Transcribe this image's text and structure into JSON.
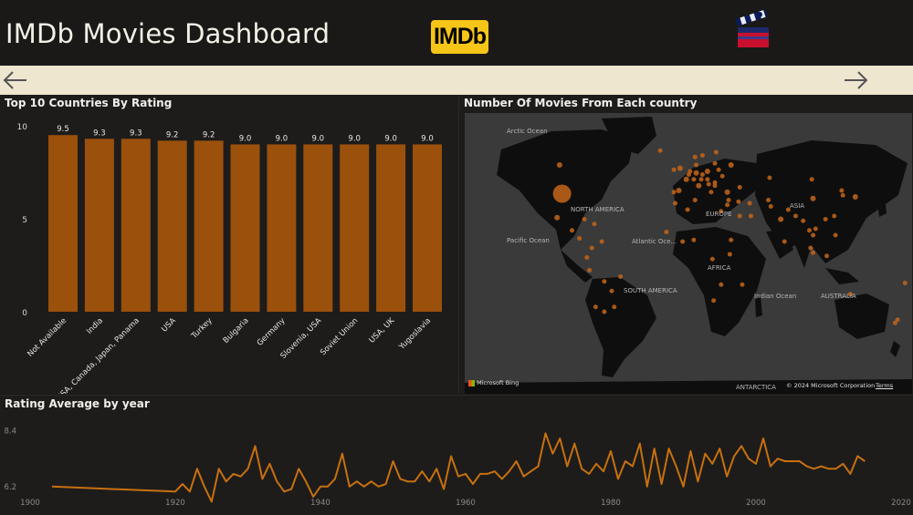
{
  "header": {
    "title": "IMDb Movies Dashboard",
    "logo_text": "IMDb"
  },
  "bar_panel": {
    "title": "Top 10 Countries By Rating"
  },
  "map_panel": {
    "title": "Number Of Movies From Each country",
    "labels": {
      "arctic": "Arctic Ocean",
      "north_america": "NORTH AMERICA",
      "europe": "EUROPE",
      "asia": "ASIA",
      "pacific": "Pacific Ocean",
      "atlantic": "Atlantic Oce...",
      "africa": "AFRICA",
      "south_america": "SOUTH AMERICA",
      "indian": "Indian Ocean",
      "australia": "AUSTRALIA",
      "antarctica": "ANTARCTICA"
    },
    "bing": "Microsoft Bing",
    "copyright": "© 2024 Microsoft Corporation",
    "terms": "Terms"
  },
  "line_panel": {
    "title": "Rating Average by year"
  },
  "colors": {
    "bar": "#9b500c",
    "line": "#c8700f",
    "dot": "#c4651a",
    "nav_bg": "#efe6d0"
  },
  "chart_data": [
    {
      "type": "bar",
      "title": "Top 10 Countries By Rating",
      "categories": [
        "Not Available",
        "India",
        "USA, Canada, Japan, Panama",
        "USA",
        "Turkey",
        "Bulgaria",
        "Germany",
        "Slovenia, USA",
        "Soviet Union",
        "USA, UK",
        "Yugoslavia"
      ],
      "values": [
        9.5,
        9.3,
        9.3,
        9.2,
        9.2,
        9.0,
        9.0,
        9.0,
        9.0,
        9.0,
        9.0
      ],
      "value_labels": [
        "9.5",
        "9.3",
        "9.3",
        "9.2",
        "9.2",
        "9.0",
        "9.0",
        "9.0",
        "9.0",
        "9.0",
        "9.0"
      ],
      "yticks": [
        "0",
        "5",
        "10"
      ],
      "ylim": [
        0,
        10
      ],
      "grid": false
    },
    {
      "type": "line",
      "title": "Rating Average by year",
      "x": [
        1903,
        1920,
        1921,
        1922,
        1923,
        1924,
        1925,
        1926,
        1927,
        1928,
        1929,
        1930,
        1931,
        1932,
        1933,
        1934,
        1935,
        1936,
        1937,
        1938,
        1939,
        1940,
        1941,
        1942,
        1943,
        1944,
        1945,
        1946,
        1947,
        1948,
        1949,
        1950,
        1951,
        1952,
        1953,
        1954,
        1955,
        1956,
        1957,
        1958,
        1959,
        1960,
        1961,
        1962,
        1963,
        1964,
        1965,
        1966,
        1967,
        1968,
        1969,
        1970,
        1971,
        1972,
        1973,
        1974,
        1975,
        1976,
        1977,
        1978,
        1979,
        1980,
        1981,
        1982,
        1983,
        1984,
        1985,
        1986,
        1987,
        1988,
        1989,
        1990,
        1991,
        1992,
        1993,
        1994,
        1995,
        1996,
        1997,
        1998,
        1999,
        2000,
        2001,
        2002,
        2003,
        2004,
        2005,
        2006,
        2007,
        2008,
        2009,
        2010,
        2011,
        2012,
        2013,
        2014,
        2015
      ],
      "y": [
        6.2,
        6.0,
        6.3,
        6.0,
        6.9,
        6.2,
        5.6,
        6.9,
        6.4,
        6.7,
        6.6,
        6.9,
        7.8,
        6.5,
        7.1,
        6.4,
        6.0,
        6.1,
        6.9,
        6.4,
        5.8,
        6.2,
        6.2,
        6.5,
        7.5,
        6.2,
        6.4,
        6.2,
        6.4,
        6.2,
        6.3,
        7.2,
        6.5,
        6.4,
        6.4,
        6.8,
        6.4,
        6.9,
        6.1,
        7.4,
        6.6,
        6.7,
        6.3,
        6.7,
        6.7,
        6.8,
        6.5,
        6.8,
        7.2,
        6.6,
        6.8,
        7.0,
        8.3,
        7.5,
        8.1,
        7.0,
        7.9,
        6.9,
        6.7,
        7.1,
        6.8,
        7.6,
        6.5,
        7.2,
        7.0,
        7.9,
        6.2,
        7.7,
        6.3,
        7.7,
        7.0,
        6.2,
        7.6,
        6.4,
        7.5,
        7.1,
        7.7,
        6.6,
        7.4,
        7.8,
        7.3,
        7.1,
        8.1,
        7.0,
        7.3,
        7.2,
        7.2,
        7.2,
        7.0,
        6.9,
        7.0,
        6.9,
        6.9,
        7.1,
        6.7,
        7.4,
        7.2,
        7.3,
        7.1,
        7.2,
        8.2
      ],
      "yticks": [
        "6.2",
        "8.4"
      ],
      "xticks": [
        "1900",
        "1920",
        "1940",
        "1960",
        "1980",
        "2000",
        "2020"
      ],
      "xlim": [
        1900,
        2020
      ],
      "ylim": [
        5.4,
        9.0
      ],
      "grid": false
    }
  ],
  "map_data": {
    "type": "bubble-map",
    "points": [
      {
        "lon": -98,
        "lat": 38,
        "r": 10
      },
      {
        "lon": -100,
        "lat": 56,
        "r": 3
      },
      {
        "lon": -102,
        "lat": 23,
        "r": 3
      },
      {
        "lon": -90,
        "lat": 15,
        "r": 2.5
      },
      {
        "lon": -84,
        "lat": 10,
        "r": 2.5
      },
      {
        "lon": -80,
        "lat": 22,
        "r": 2.5
      },
      {
        "lon": -72,
        "lat": 19,
        "r": 2.5
      },
      {
        "lon": -74,
        "lat": 4,
        "r": 2.5
      },
      {
        "lon": -66,
        "lat": 8,
        "r": 2.5
      },
      {
        "lon": -78,
        "lat": -2,
        "r": 2.5
      },
      {
        "lon": -76,
        "lat": -10,
        "r": 2.5
      },
      {
        "lon": -64,
        "lat": -17,
        "r": 2.5
      },
      {
        "lon": -51,
        "lat": -14,
        "r": 2.5
      },
      {
        "lon": -58,
        "lat": -23,
        "r": 2.5
      },
      {
        "lon": -71,
        "lat": -33,
        "r": 2.5
      },
      {
        "lon": -64,
        "lat": -36,
        "r": 2.5
      },
      {
        "lon": -56,
        "lat": -33,
        "r": 2.5
      },
      {
        "lon": -19,
        "lat": 65,
        "r": 2.5
      },
      {
        "lon": -8,
        "lat": 53,
        "r": 2.5
      },
      {
        "lon": -3,
        "lat": 54,
        "r": 3
      },
      {
        "lon": 2,
        "lat": 47,
        "r": 3
      },
      {
        "lon": 5,
        "lat": 52,
        "r": 2.5
      },
      {
        "lon": 4,
        "lat": 50,
        "r": 2.5
      },
      {
        "lon": 10,
        "lat": 51,
        "r": 3
      },
      {
        "lon": 8,
        "lat": 47,
        "r": 2.5
      },
      {
        "lon": 14,
        "lat": 47,
        "r": 2.5
      },
      {
        "lon": 12,
        "lat": 43,
        "r": 3
      },
      {
        "lon": -4,
        "lat": 40,
        "r": 3
      },
      {
        "lon": -8,
        "lat": 39,
        "r": 2.5
      },
      {
        "lon": 10,
        "lat": 56,
        "r": 2.5
      },
      {
        "lon": 15,
        "lat": 62,
        "r": 2.5
      },
      {
        "lon": 9,
        "lat": 61,
        "r": 2.5
      },
      {
        "lon": 26,
        "lat": 64,
        "r": 2.5
      },
      {
        "lon": 19,
        "lat": 52,
        "r": 3
      },
      {
        "lon": 15,
        "lat": 50,
        "r": 2.5
      },
      {
        "lon": 19,
        "lat": 47,
        "r": 2.5
      },
      {
        "lon": 20,
        "lat": 44,
        "r": 2.5
      },
      {
        "lon": 25,
        "lat": 45,
        "r": 2.5
      },
      {
        "lon": 25,
        "lat": 43,
        "r": 2.5
      },
      {
        "lon": 22,
        "lat": 39,
        "r": 2.5
      },
      {
        "lon": 35,
        "lat": 39,
        "r": 3
      },
      {
        "lon": 31,
        "lat": 49,
        "r": 2.5
      },
      {
        "lon": 28,
        "lat": 53,
        "r": 2.5
      },
      {
        "lon": 38,
        "lat": 56,
        "r": 3
      },
      {
        "lon": 25,
        "lat": 57,
        "r": 2.5
      },
      {
        "lon": 45,
        "lat": 42,
        "r": 2.5
      },
      {
        "lon": 35,
        "lat": 31,
        "r": 2.5
      },
      {
        "lon": 36,
        "lat": 34,
        "r": 2.5
      },
      {
        "lon": 44,
        "lat": 33,
        "r": 2.5
      },
      {
        "lon": 53,
        "lat": 32,
        "r": 2.5
      },
      {
        "lon": 45,
        "lat": 24,
        "r": 2.5
      },
      {
        "lon": 54,
        "lat": 24,
        "r": 2.5
      },
      {
        "lon": 30,
        "lat": 27,
        "r": 2.5
      },
      {
        "lon": 9,
        "lat": 34,
        "r": 2.5
      },
      {
        "lon": 3,
        "lat": 28,
        "r": 2.5
      },
      {
        "lon": -7,
        "lat": 32,
        "r": 2.5
      },
      {
        "lon": -14,
        "lat": 14,
        "r": 2.5
      },
      {
        "lon": 8,
        "lat": 9,
        "r": 2.5
      },
      {
        "lon": -1,
        "lat": 8,
        "r": 2.5
      },
      {
        "lon": 38,
        "lat": 9,
        "r": 2.5
      },
      {
        "lon": 37,
        "lat": 0,
        "r": 2.5
      },
      {
        "lon": 23,
        "lat": -3,
        "r": 2.5
      },
      {
        "lon": 30,
        "lat": -19,
        "r": 2.5
      },
      {
        "lon": 24,
        "lat": -29,
        "r": 2.5
      },
      {
        "lon": 47,
        "lat": -19,
        "r": 2.5
      },
      {
        "lon": 69,
        "lat": 48,
        "r": 2.5
      },
      {
        "lon": 68,
        "lat": 34,
        "r": 2.5
      },
      {
        "lon": 70,
        "lat": 30,
        "r": 2.5
      },
      {
        "lon": 78,
        "lat": 22,
        "r": 3
      },
      {
        "lon": 84,
        "lat": 28,
        "r": 2.5
      },
      {
        "lon": 90,
        "lat": 24,
        "r": 2.5
      },
      {
        "lon": 81,
        "lat": 8,
        "r": 2.5
      },
      {
        "lon": 104,
        "lat": 35,
        "r": 3
      },
      {
        "lon": 103,
        "lat": 47,
        "r": 2.5
      },
      {
        "lon": 128,
        "lat": 37,
        "r": 2.5
      },
      {
        "lon": 127,
        "lat": 40,
        "r": 2.5
      },
      {
        "lon": 138,
        "lat": 36,
        "r": 3
      },
      {
        "lon": 121,
        "lat": 24,
        "r": 2.5
      },
      {
        "lon": 114,
        "lat": 22,
        "r": 2.5
      },
      {
        "lon": 101,
        "lat": 15,
        "r": 2.5
      },
      {
        "lon": 106,
        "lat": 16,
        "r": 2.5
      },
      {
        "lon": 104,
        "lat": 12,
        "r": 2.5
      },
      {
        "lon": 96,
        "lat": 21,
        "r": 2.5
      },
      {
        "lon": 102,
        "lat": 4,
        "r": 2.5
      },
      {
        "lon": 104,
        "lat": 1,
        "r": 2.5
      },
      {
        "lon": 115,
        "lat": -1,
        "r": 2.5
      },
      {
        "lon": 122,
        "lat": 12,
        "r": 2.5
      },
      {
        "lon": 134,
        "lat": -25,
        "r": 2.5
      },
      {
        "lon": 172,
        "lat": -41,
        "r": 2.5
      },
      {
        "lon": 178,
        "lat": -18,
        "r": 2.5
      },
      {
        "lon": 170,
        "lat": -43,
        "r": 2.5
      }
    ]
  }
}
